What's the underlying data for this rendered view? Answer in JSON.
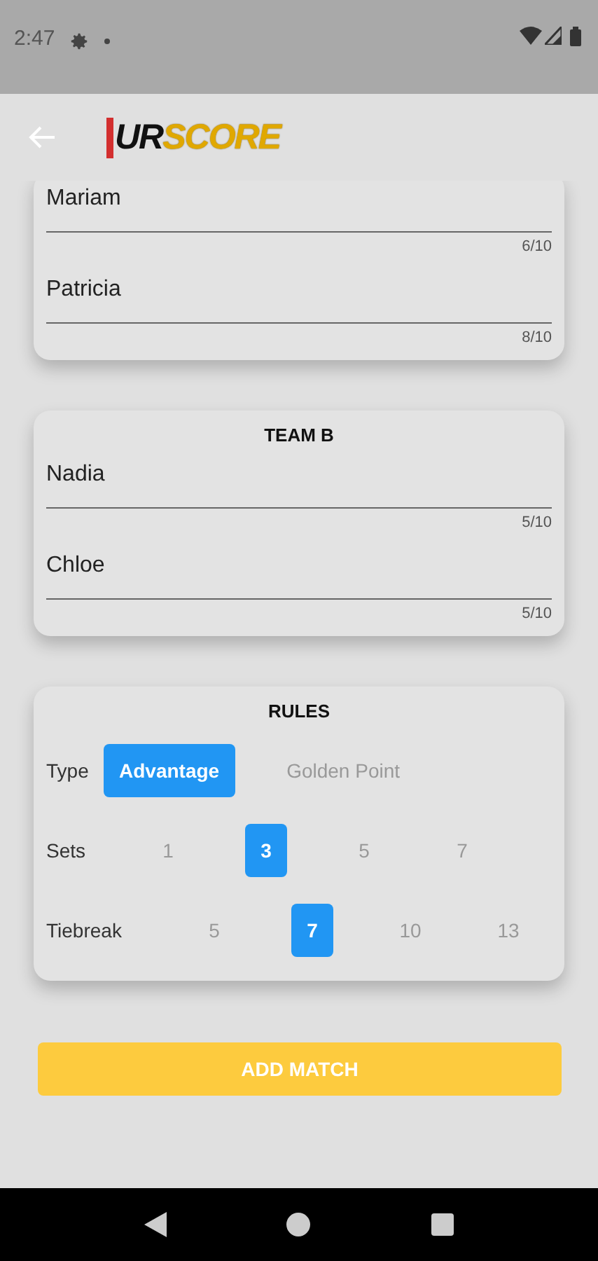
{
  "status_bar": {
    "time": "2:47"
  },
  "app_bar": {
    "logo": {
      "mark": "UR",
      "word": "SCORE"
    }
  },
  "teams": [
    {
      "players": [
        {
          "value": "Mariam",
          "counter": "6/10"
        },
        {
          "value": "Patricia",
          "counter": "8/10"
        }
      ]
    },
    {
      "title": "TEAM B",
      "players": [
        {
          "value": "Nadia",
          "counter": "5/10"
        },
        {
          "value": "Chloe",
          "counter": "5/10"
        }
      ]
    }
  ],
  "rules": {
    "title": "RULES",
    "rows": [
      {
        "label": "Type",
        "kind": "wide",
        "options": [
          {
            "label": "Advantage",
            "selected": true
          },
          {
            "label": "Golden Point",
            "selected": false
          }
        ]
      },
      {
        "label": "Sets",
        "kind": "narrow",
        "options": [
          {
            "label": "1",
            "selected": false
          },
          {
            "label": "3",
            "selected": true
          },
          {
            "label": "5",
            "selected": false
          },
          {
            "label": "7",
            "selected": false
          }
        ]
      },
      {
        "label": "Tiebreak",
        "kind": "narrow",
        "options": [
          {
            "label": "5",
            "selected": false
          },
          {
            "label": "7",
            "selected": true
          },
          {
            "label": "10",
            "selected": false
          },
          {
            "label": "13",
            "selected": false
          }
        ]
      }
    ]
  },
  "add_button": "ADD MATCH"
}
